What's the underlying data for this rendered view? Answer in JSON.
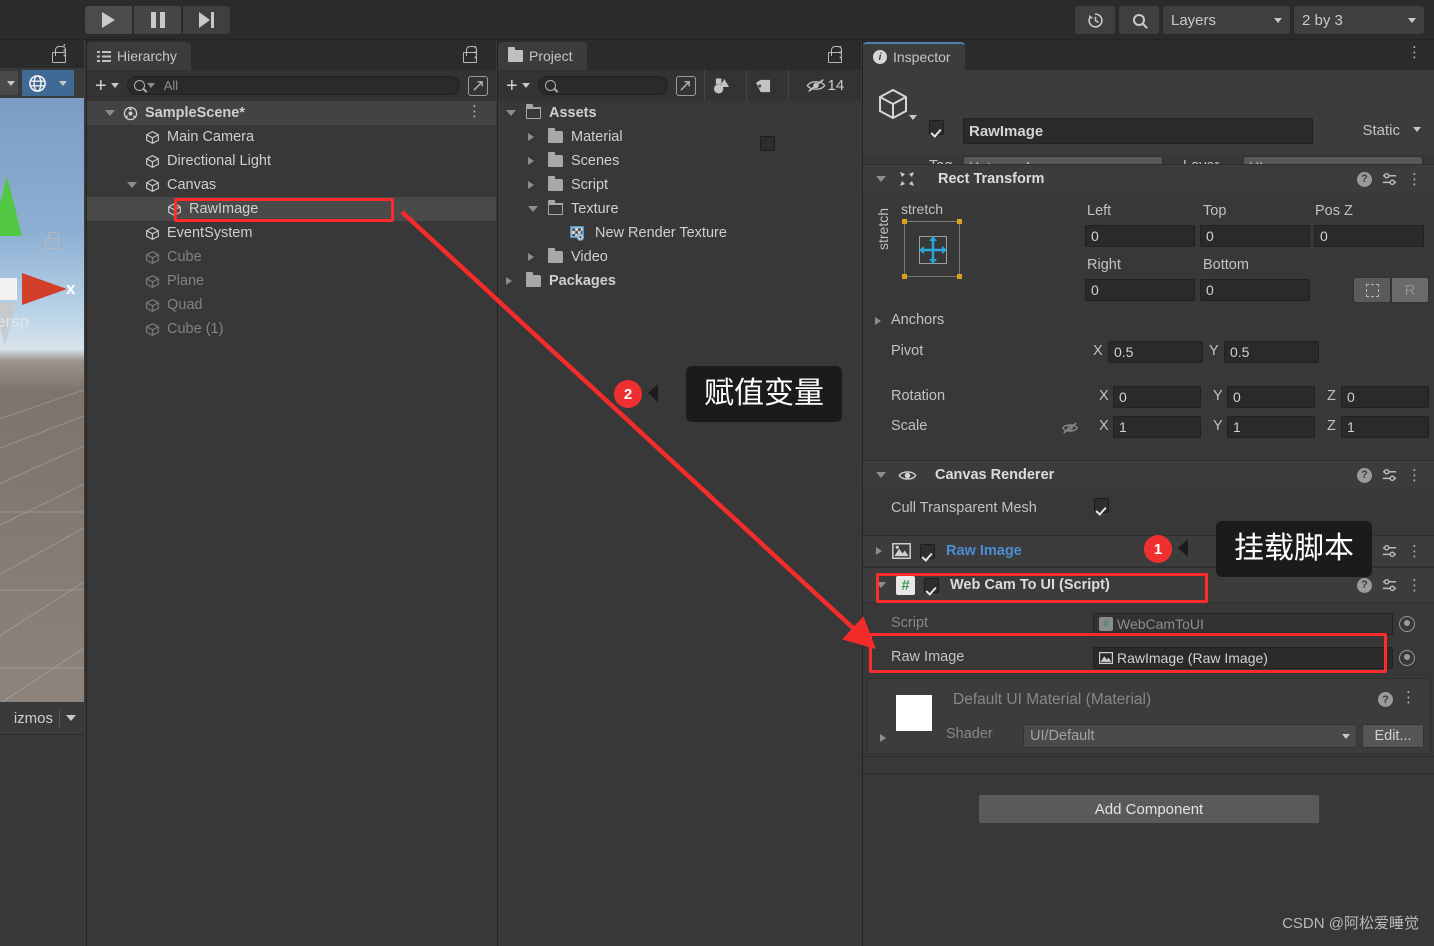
{
  "toolbar": {
    "play_label": "play-icon",
    "pause_label": "pause-icon",
    "step_label": "step-icon",
    "history_label": "history-icon",
    "search_label": "search-icon",
    "layers_label": "Layers",
    "layout_label": "2 by 3"
  },
  "scene_view": {
    "persp_label": "ersp",
    "gizmos_label": "izmos",
    "axis_x_label": "x"
  },
  "hierarchy": {
    "tab_label": "Hierarchy",
    "search_placeholder": "All",
    "items": [
      {
        "label": "SampleScene*",
        "depth": 0,
        "icon": "scene-icon",
        "expanded": true,
        "dim": false,
        "selected": false
      },
      {
        "label": "Main Camera",
        "depth": 1,
        "icon": "gameobject-icon",
        "expanded": null,
        "dim": false,
        "selected": false
      },
      {
        "label": "Directional Light",
        "depth": 1,
        "icon": "gameobject-icon",
        "expanded": null,
        "dim": false,
        "selected": false
      },
      {
        "label": "Canvas",
        "depth": 1,
        "icon": "gameobject-icon",
        "expanded": true,
        "dim": false,
        "selected": false
      },
      {
        "label": "RawImage",
        "depth": 2,
        "icon": "gameobject-icon",
        "expanded": null,
        "dim": false,
        "selected": true
      },
      {
        "label": "EventSystem",
        "depth": 1,
        "icon": "gameobject-icon",
        "expanded": null,
        "dim": false,
        "selected": false
      },
      {
        "label": "Cube",
        "depth": 1,
        "icon": "gameobject-icon",
        "expanded": null,
        "dim": true,
        "selected": false
      },
      {
        "label": "Plane",
        "depth": 1,
        "icon": "gameobject-icon",
        "expanded": null,
        "dim": true,
        "selected": false
      },
      {
        "label": "Quad",
        "depth": 1,
        "icon": "gameobject-icon",
        "expanded": null,
        "dim": true,
        "selected": false
      },
      {
        "label": "Cube (1)",
        "depth": 1,
        "icon": "gameobject-icon",
        "expanded": null,
        "dim": true,
        "selected": false
      }
    ]
  },
  "project": {
    "tab_label": "Project",
    "search_placeholder": "",
    "hidden_count": "14",
    "items": [
      {
        "label": "Assets",
        "depth": 0,
        "icon": "folder-open-icon",
        "expanded": true,
        "bold": true
      },
      {
        "label": "Material",
        "depth": 1,
        "icon": "folder-icon",
        "expanded": false,
        "bold": false
      },
      {
        "label": "Scenes",
        "depth": 1,
        "icon": "folder-icon",
        "expanded": false,
        "bold": false
      },
      {
        "label": "Script",
        "depth": 1,
        "icon": "folder-icon",
        "expanded": false,
        "bold": false
      },
      {
        "label": "Texture",
        "depth": 1,
        "icon": "folder-open-icon",
        "expanded": true,
        "bold": false
      },
      {
        "label": "New Render Texture",
        "depth": 2,
        "icon": "render-texture-icon",
        "expanded": null,
        "bold": false
      },
      {
        "label": "Video",
        "depth": 1,
        "icon": "folder-icon",
        "expanded": false,
        "bold": false
      },
      {
        "label": "Packages",
        "depth": 0,
        "icon": "folder-icon",
        "expanded": false,
        "bold": true
      }
    ]
  },
  "inspector": {
    "tab_label": "Inspector",
    "object_name": "RawImage",
    "object_enabled": true,
    "static_label": "Static",
    "tag_label": "Tag",
    "tag_value": "Untagged",
    "layer_label": "Layer",
    "layer_value": "UI",
    "rect_transform": {
      "title": "Rect Transform",
      "anchor_preset_top": "stretch",
      "anchor_preset_side": "stretch",
      "left_label": "Left",
      "left_value": "0",
      "top_label": "Top",
      "top_value": "0",
      "posz_label": "Pos Z",
      "posz_value": "0",
      "right_label": "Right",
      "right_value": "0",
      "bottom_label": "Bottom",
      "bottom_value": "0",
      "blueprint_label": "blueprint-mode-icon",
      "raw_label": "R",
      "anchors_label": "Anchors",
      "pivot_label": "Pivot",
      "pivot_x": "0.5",
      "pivot_y": "0.5",
      "rotation_label": "Rotation",
      "rotation_x": "0",
      "rotation_y": "0",
      "rotation_z": "0",
      "scale_label": "Scale",
      "scale_x": "1",
      "scale_y": "1",
      "scale_z": "1",
      "axis_x": "X",
      "axis_y": "Y",
      "axis_z": "Z"
    },
    "canvas_renderer": {
      "title": "Canvas Renderer",
      "cull_label": "Cull Transparent Mesh",
      "cull_checked": true
    },
    "raw_image_component": {
      "title": "Raw Image",
      "enabled": true
    },
    "script_component": {
      "title": "Web Cam To UI (Script)",
      "enabled": true,
      "script_label": "Script",
      "script_value": "WebCamToUI",
      "rawimage_label": "Raw Image",
      "rawimage_value": "RawImage (Raw Image)"
    },
    "material": {
      "title": "Default UI Material (Material)",
      "shader_label": "Shader",
      "shader_value": "UI/Default",
      "edit_label": "Edit..."
    },
    "add_component_label": "Add Component"
  },
  "annotations": {
    "callout1_badge": "1",
    "callout1_text": "挂载脚本",
    "callout2_badge": "2",
    "callout2_text": "赋值变量"
  },
  "watermark": "CSDN @阿松爱睡觉",
  "colors": {
    "accent_red": "#fd2b2b",
    "link_blue": "#4b8dd6",
    "panel_bg": "#383838",
    "header_bg": "#3c3c3c",
    "toolbar_bg": "#2b2b2b"
  }
}
